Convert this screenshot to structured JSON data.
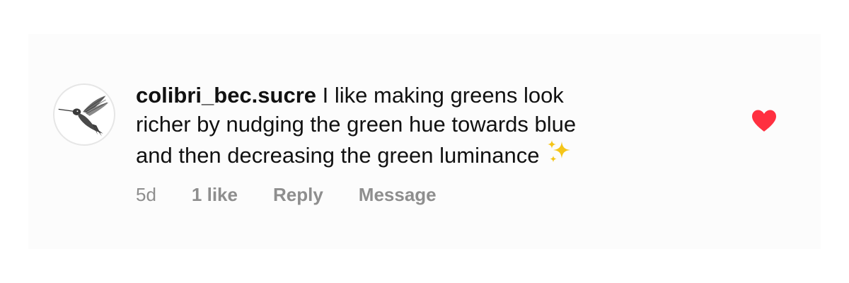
{
  "comment": {
    "username": "colibri_bec.sucre",
    "text_lines": [
      "I like making  greens look",
      "richer by nudging the green hue towards blue",
      "and then decreasing the green luminance"
    ],
    "emoji": "✨",
    "time": "5d",
    "likes": "1 like",
    "reply_label": "Reply",
    "message_label": "Message",
    "liked": true,
    "avatar_icon": "hummingbird-icon",
    "like_icon": "heart-icon"
  },
  "colors": {
    "heart": "#ff3040",
    "meta_text": "#8e8e8e",
    "body_text": "#111111",
    "panel_bg": "#fcfcfc"
  }
}
